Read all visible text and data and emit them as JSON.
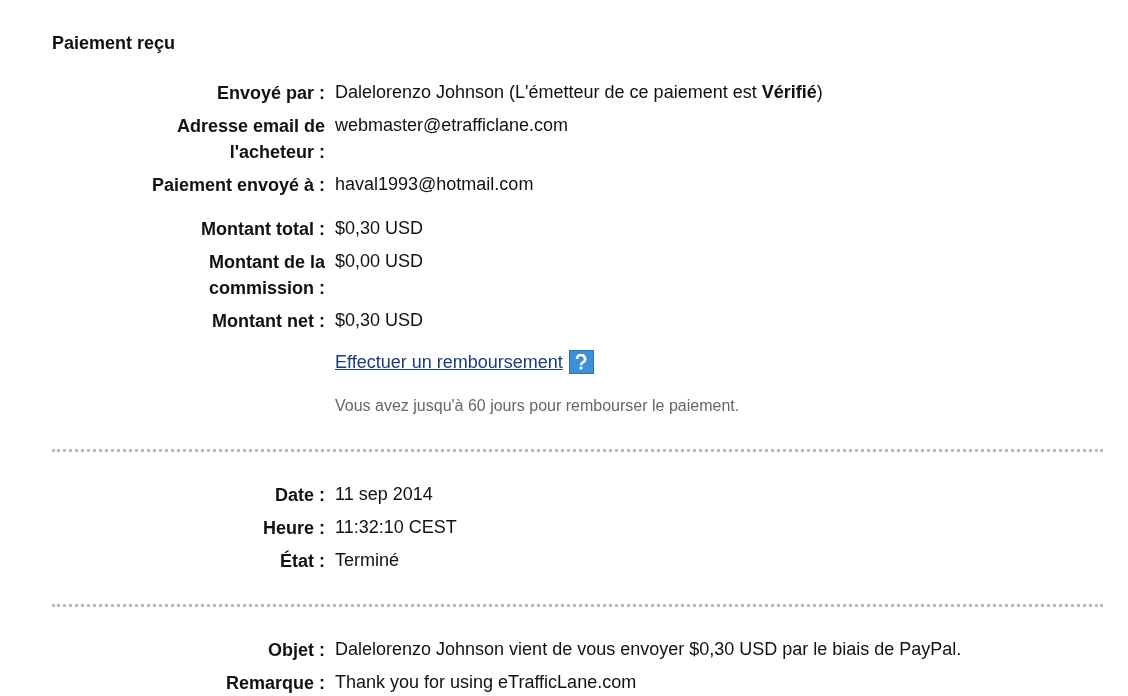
{
  "title": "Paiement reçu",
  "sections": [
    {
      "groups": [
        {
          "rows": [
            {
              "kind": "field",
              "label_lines": [
                "Envoyé par :"
              ],
              "value": "Dalelorenzo Johnson (L'émetteur de ce paiement est **Vérifié**)"
            },
            {
              "kind": "field",
              "label_lines": [
                "Adresse email de",
                "l'acheteur :"
              ],
              "value": "webmaster@etrafficlane.com"
            },
            {
              "kind": "field",
              "label_lines": [
                "Paiement envoyé à :"
              ],
              "value": "haval1993@hotmail.com"
            }
          ]
        },
        {
          "rows": [
            {
              "kind": "field",
              "label_lines": [
                "Montant total :"
              ],
              "value": "$0,30 USD"
            },
            {
              "kind": "field",
              "label_lines": [
                "Montant de la",
                "commission :"
              ],
              "value": "$0,00 USD"
            },
            {
              "kind": "field",
              "label_lines": [
                "Montant net :"
              ],
              "value": "$0,30 USD"
            },
            {
              "kind": "link",
              "value": "Effectuer un remboursement"
            },
            {
              "kind": "note",
              "value": "Vous avez jusqu'à 60 jours pour rembourser le paiement."
            }
          ]
        }
      ]
    },
    {
      "groups": [
        {
          "rows": [
            {
              "kind": "field",
              "label_lines": [
                "Date :"
              ],
              "value": "11 sep 2014"
            },
            {
              "kind": "field",
              "label_lines": [
                "Heure :"
              ],
              "value": "11:32:10 CEST"
            },
            {
              "kind": "field",
              "label_lines": [
                "État :"
              ],
              "value": "Terminé"
            }
          ]
        }
      ]
    },
    {
      "groups": [
        {
          "rows": [
            {
              "kind": "field",
              "label_lines": [
                "Objet :"
              ],
              "value": "Dalelorenzo Johnson vient de vous envoyer $0,30 USD par le biais de PayPal."
            },
            {
              "kind": "field",
              "label_lines": [
                "Remarque :"
              ],
              "value": "Thank you for using eTrafficLane.com"
            }
          ]
        }
      ]
    }
  ]
}
